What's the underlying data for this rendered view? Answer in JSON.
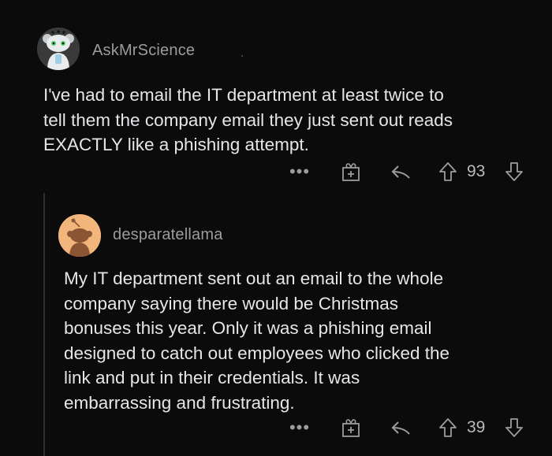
{
  "comments": [
    {
      "username": "AskMrScience",
      "text": "I've had to email the IT department at least twice to\ntell them the company email they just sent out reads\nEXACTLY like a phishing attempt.",
      "more": "•••",
      "score": "93",
      "icons": {
        "more": "more-options-icon",
        "award": "award-icon",
        "reply": "reply-icon",
        "upvote": "upvote-icon",
        "downvote": "downvote-icon"
      }
    },
    {
      "username": "desparatellama",
      "text": "My IT department sent out an email to the whole\ncompany saying there would be Christmas\nbonuses this year. Only it was a phishing email\ndesigned to catch out employees who clicked the\nlink and put in their credentials. It was\nembarrassing and frustrating.",
      "more": "•••",
      "score": "39",
      "icons": {
        "more": "more-options-icon",
        "award": "award-icon",
        "reply": "reply-icon",
        "upvote": "upvote-icon",
        "downvote": "downvote-icon"
      }
    }
  ],
  "colors": {
    "background": "#0b0b0b",
    "text": "#e4e6e8",
    "muted": "#9a9c9e",
    "avatar2_bg": "#f2b57b"
  }
}
